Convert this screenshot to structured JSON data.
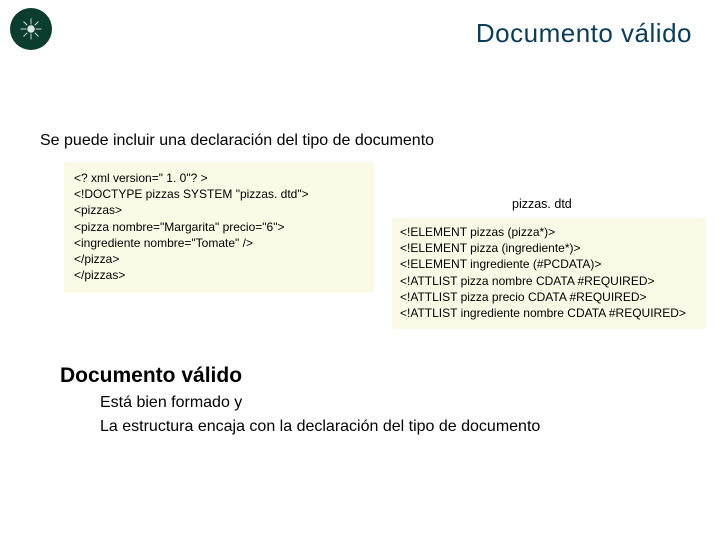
{
  "title": "Documento válido",
  "intro": "Se puede incluir una declaración del tipo de documento",
  "xml_lines": [
    "<? xml version=\" 1. 0\"? >",
    "<!DOCTYPE pizzas SYSTEM \"pizzas. dtd\">",
    "<pizzas>",
    "<pizza nombre=\"Margarita\" precio=\"6\">",
    "<ingrediente nombre=\"Tomate\" />",
    "</pizza>",
    "</pizzas>"
  ],
  "dtd_label": "pizzas. dtd",
  "dtd_lines": [
    "<!ELEMENT pizzas (pizza*)>",
    "<!ELEMENT pizza (ingrediente*)>",
    "<!ELEMENT ingrediente (#PCDATA)>",
    "<!ATTLIST pizza nombre CDATA #REQUIRED>",
    "<!ATTLIST pizza precio CDATA #REQUIRED>",
    "<!ATTLIST ingrediente nombre CDATA #REQUIRED>"
  ],
  "heading2": "Documento válido",
  "body1": "Está bien formado y",
  "body2": "La estructura encaja con la declaración del tipo de documento"
}
